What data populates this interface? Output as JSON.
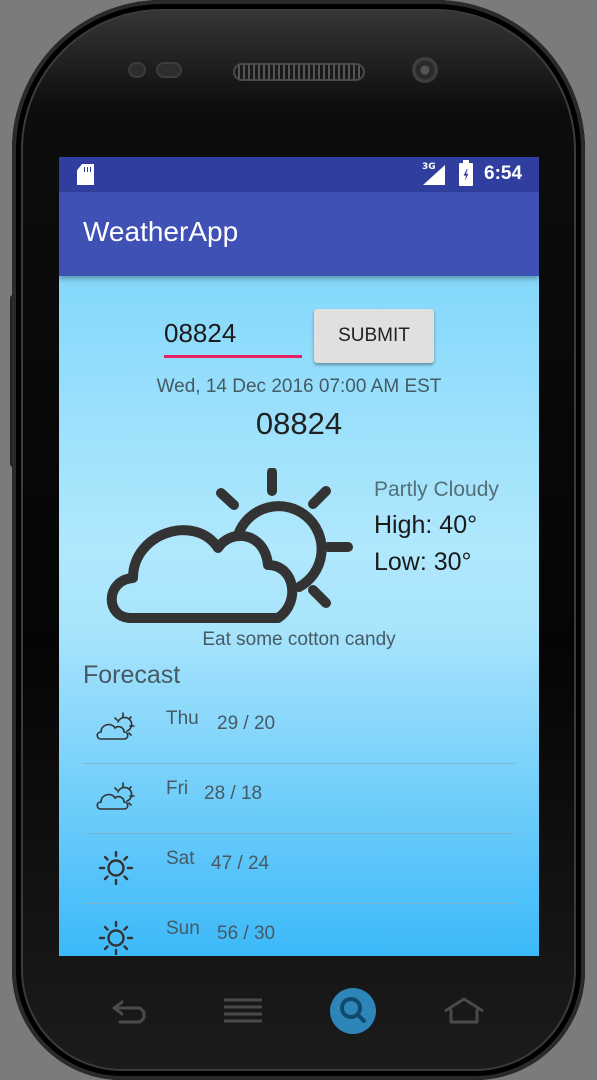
{
  "status_bar": {
    "network": "3G",
    "time": "6:54"
  },
  "app_bar": {
    "title": "WeatherApp"
  },
  "search": {
    "zip_value": "08824",
    "submit_label": "SUBMIT"
  },
  "current": {
    "datetime": "Wed, 14 Dec 2016 07:00 AM EST",
    "location": "08824",
    "icon": "partly-cloudy-icon",
    "condition": "Partly Cloudy",
    "high": "High: 40°",
    "low": "Low: 30°",
    "tip": "Eat some cotton candy"
  },
  "forecast": {
    "title": "Forecast",
    "days": [
      {
        "day": "Thu",
        "temps": "29 / 20",
        "icon": "partly-cloudy-icon"
      },
      {
        "day": "Fri",
        "temps": "28 / 18",
        "icon": "partly-cloudy-icon"
      },
      {
        "day": "Sat",
        "temps": "47 / 24",
        "icon": "sun-icon"
      },
      {
        "day": "Sun",
        "temps": "56 / 30",
        "icon": "sun-icon"
      }
    ]
  },
  "colors": {
    "status_bar": "#303f9f",
    "app_bar": "#3f51b5",
    "accent": "#e91e63",
    "gradient_top": "#84d8fb",
    "gradient_bottom": "#3cb9f9"
  }
}
